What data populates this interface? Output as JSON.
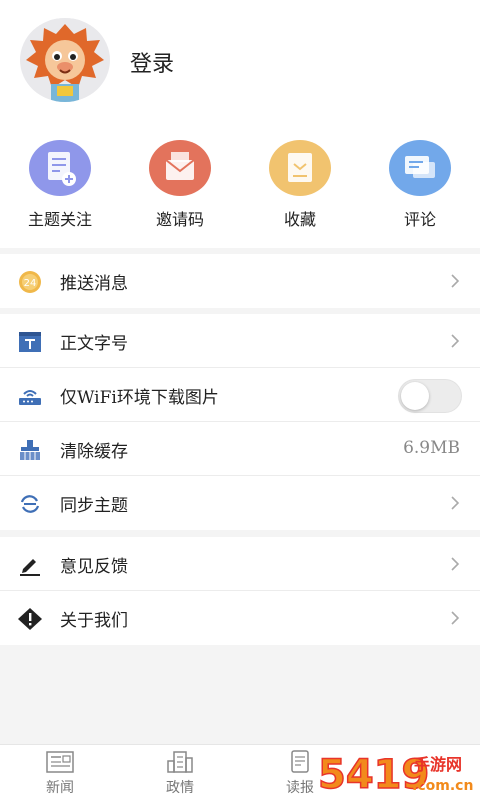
{
  "profile": {
    "login_label": "登录",
    "avatar_icon": "lion-mascot-avatar"
  },
  "quick_actions": [
    {
      "label": "主题关注",
      "icon": "topic-follow-icon",
      "color": "#8f97ea"
    },
    {
      "label": "邀请码",
      "icon": "invite-code-icon",
      "color": "#e3735c"
    },
    {
      "label": "收藏",
      "icon": "favorites-icon",
      "color": "#f1c36f"
    },
    {
      "label": "评论",
      "icon": "comment-icon",
      "color": "#72a8ea"
    }
  ],
  "settings": {
    "push": {
      "label": "推送消息",
      "badge": "24",
      "icon": "push-badge-icon"
    },
    "font_size": {
      "label": "正文字号",
      "icon": "text-size-icon"
    },
    "wifi_images": {
      "label": "仅WiFi环境下载图片",
      "enabled": false,
      "icon": "wifi-router-icon"
    },
    "clear_cache": {
      "label": "清除缓存",
      "value": "6.9MB",
      "icon": "broom-icon"
    },
    "sync_topics": {
      "label": "同步主题",
      "icon": "sync-icon"
    },
    "feedback": {
      "label": "意见反馈",
      "icon": "pencil-icon"
    },
    "about": {
      "label": "关于我们",
      "icon": "info-diamond-icon"
    }
  },
  "tabbar": {
    "items": [
      {
        "label": "新闻",
        "icon": "newspaper-icon"
      },
      {
        "label": "政情",
        "icon": "building-icon"
      },
      {
        "label": "读报",
        "icon": "document-icon"
      }
    ]
  },
  "watermark": {
    "brand": "5419",
    "text": "手游网",
    "domain": ".com.cn"
  },
  "colors": {
    "accent_blue": "#3f6fb6",
    "badge_gold": "#f0b84a",
    "watermark_orange": "#f28a1b",
    "watermark_red": "#e8342a"
  }
}
